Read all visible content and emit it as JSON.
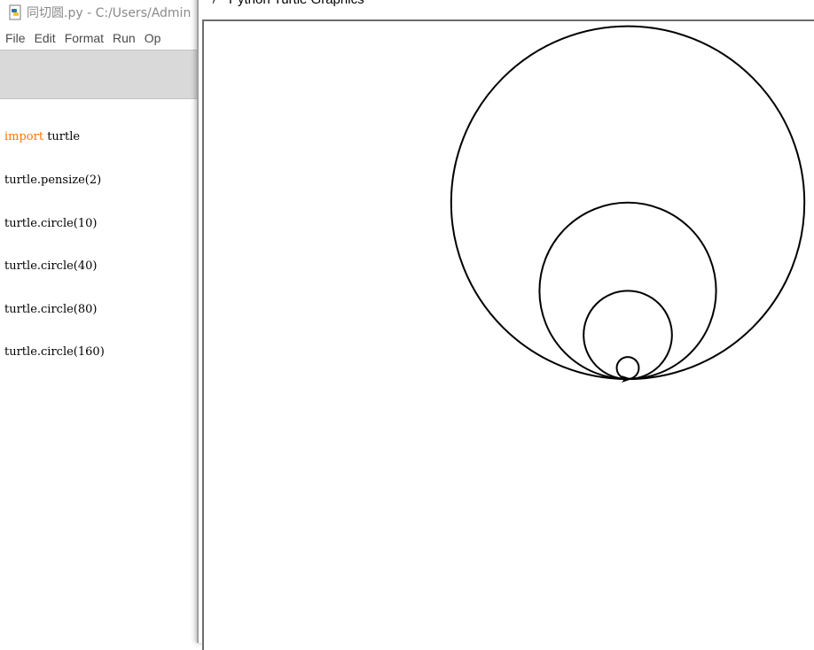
{
  "idle": {
    "title": "同切圆.py - C:/Users/Admin",
    "menu": [
      "File",
      "Edit",
      "Format",
      "Run",
      "Op"
    ],
    "code": [
      {
        "kw": "import",
        "rest": " turtle"
      },
      {
        "kw": "",
        "rest": "turtle.pensize(2)"
      },
      {
        "kw": "",
        "rest": "turtle.circle(10)"
      },
      {
        "kw": "",
        "rest": "turtle.circle(40)"
      },
      {
        "kw": "",
        "rest": "turtle.circle(80)"
      },
      {
        "kw": "",
        "rest": "turtle.circle(160)"
      }
    ],
    "icon": "python-file-icon"
  },
  "turtle_window": {
    "title": "Python Turtle Graphics",
    "icon": "feather-icon",
    "pensize": 2,
    "circle_radii": [
      10,
      40,
      80,
      160
    ],
    "pen_color": "#000000"
  },
  "colors": {
    "keyword": "#ff7700",
    "menu_text": "#4a4a4a",
    "title_text": "#8a8a8a"
  }
}
